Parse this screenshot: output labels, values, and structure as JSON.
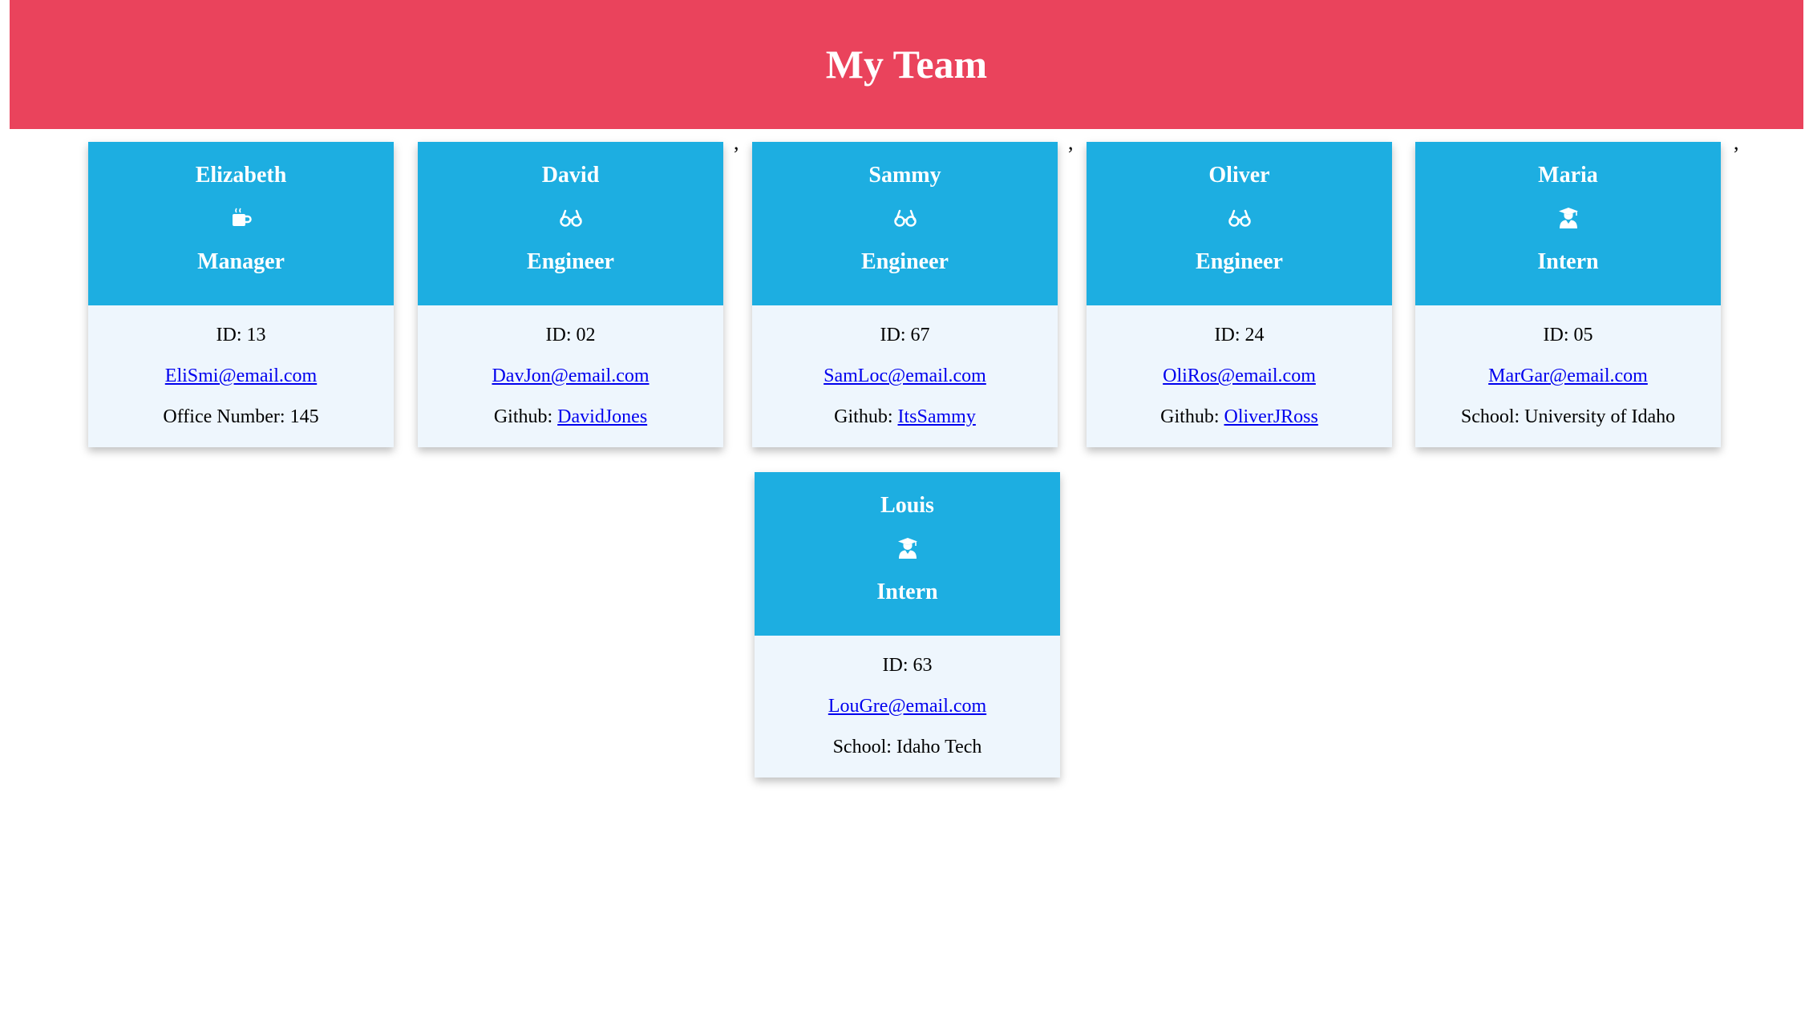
{
  "header": {
    "title": "My Team"
  },
  "separator": ",",
  "cards": [
    {
      "name": "Elizabeth",
      "icon": "coffee-mug-icon",
      "role": "Manager",
      "id_text": "ID: 13",
      "email": "EliSmi@email.com",
      "extra_label": "Office Number: 145",
      "extra_link": ""
    },
    {
      "name": "David",
      "icon": "glasses-icon",
      "role": "Engineer",
      "id_text": "ID: 02",
      "email": "DavJon@email.com",
      "extra_label": "Github: ",
      "extra_link": "DavidJones"
    },
    {
      "name": "Sammy",
      "icon": "glasses-icon",
      "role": "Engineer",
      "id_text": "ID: 67",
      "email": "SamLoc@email.com",
      "extra_label": "Github: ",
      "extra_link": "ItsSammy"
    },
    {
      "name": "Oliver",
      "icon": "glasses-icon",
      "role": "Engineer",
      "id_text": "ID: 24",
      "email": "OliRos@email.com",
      "extra_label": "Github: ",
      "extra_link": "OliverJRoss"
    },
    {
      "name": "Maria",
      "icon": "graduate-icon",
      "role": "Intern",
      "id_text": "ID: 05",
      "email": "MarGar@email.com",
      "extra_label": "School: University of Idaho",
      "extra_link": ""
    },
    {
      "name": "Louis",
      "icon": "graduate-icon",
      "role": "Intern",
      "id_text": "ID: 63",
      "email": "LouGre@email.com",
      "extra_label": "School: Idaho Tech",
      "extra_link": ""
    }
  ]
}
